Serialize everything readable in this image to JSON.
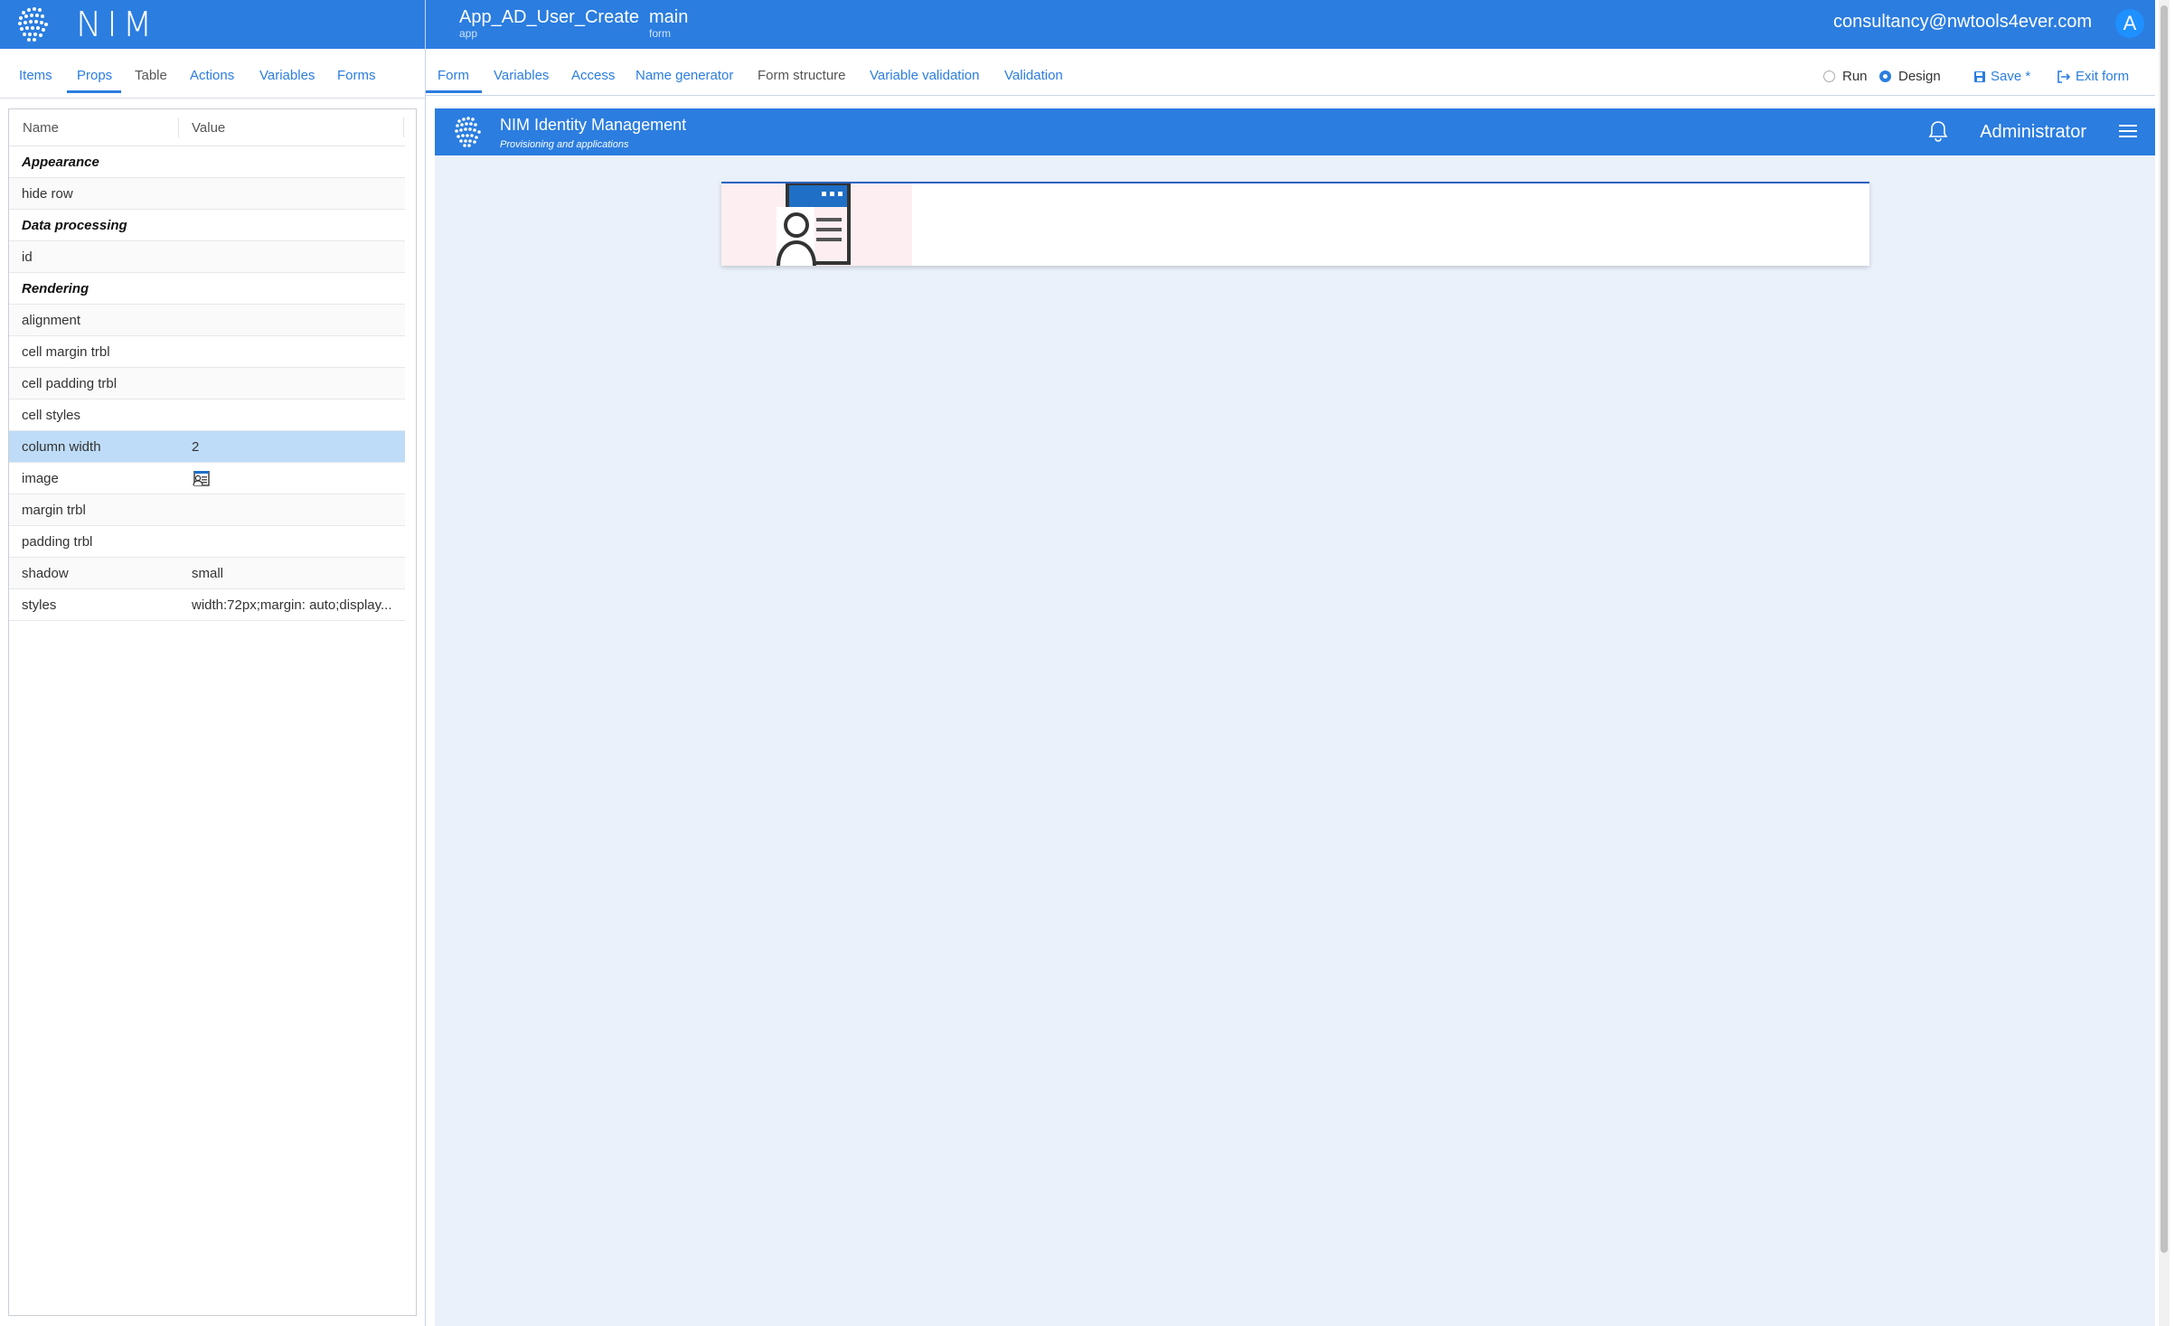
{
  "brand": {
    "name": "NIM"
  },
  "breadcrumb": [
    {
      "value": "App_AD_User_Create",
      "type": "app"
    },
    {
      "value": "main",
      "type": "form"
    }
  ],
  "user": {
    "email": "consultancy@nwtools4ever.com",
    "avatar_letter": "A"
  },
  "left_tabs": [
    {
      "label": "Items"
    },
    {
      "label": "Props",
      "active": true
    },
    {
      "label": "Table"
    },
    {
      "label": "Actions"
    },
    {
      "label": "Variables"
    },
    {
      "label": "Forms"
    }
  ],
  "main_tabs": [
    {
      "label": "Form",
      "active": true
    },
    {
      "label": "Variables"
    },
    {
      "label": "Access"
    },
    {
      "label": "Name generator"
    },
    {
      "label": "Form structure"
    },
    {
      "label": "Variable validation"
    },
    {
      "label": "Validation"
    }
  ],
  "mode": {
    "run_label": "Run",
    "design_label": "Design",
    "selected": "Design"
  },
  "actions": {
    "save_label": "Save *",
    "exit_label": "Exit form"
  },
  "props_grid": {
    "columns": [
      "Name",
      "Value"
    ],
    "rows": [
      {
        "name": "Appearance",
        "group": true
      },
      {
        "name": "hide row",
        "value": ""
      },
      {
        "name": "Data processing",
        "group": true
      },
      {
        "name": "id",
        "value": ""
      },
      {
        "name": "Rendering",
        "group": true
      },
      {
        "name": "alignment",
        "value": ""
      },
      {
        "name": "cell margin trbl",
        "value": ""
      },
      {
        "name": "cell padding trbl",
        "value": ""
      },
      {
        "name": "cell styles",
        "value": ""
      },
      {
        "name": "column width",
        "value": "2",
        "selected": true
      },
      {
        "name": "image",
        "value": "",
        "icon": "user-card-icon"
      },
      {
        "name": "margin trbl",
        "value": ""
      },
      {
        "name": "padding trbl",
        "value": ""
      },
      {
        "name": "shadow",
        "value": "small"
      },
      {
        "name": "styles",
        "value": "width:72px;margin: auto;display..."
      }
    ]
  },
  "preview": {
    "title": "NIM Identity Management",
    "subtitle": "Provisioning and applications",
    "user_label": "Administrator"
  },
  "colors": {
    "accent": "#2b7de0",
    "canvas": "#eaf1fb",
    "selected_row": "#bedcf7"
  }
}
